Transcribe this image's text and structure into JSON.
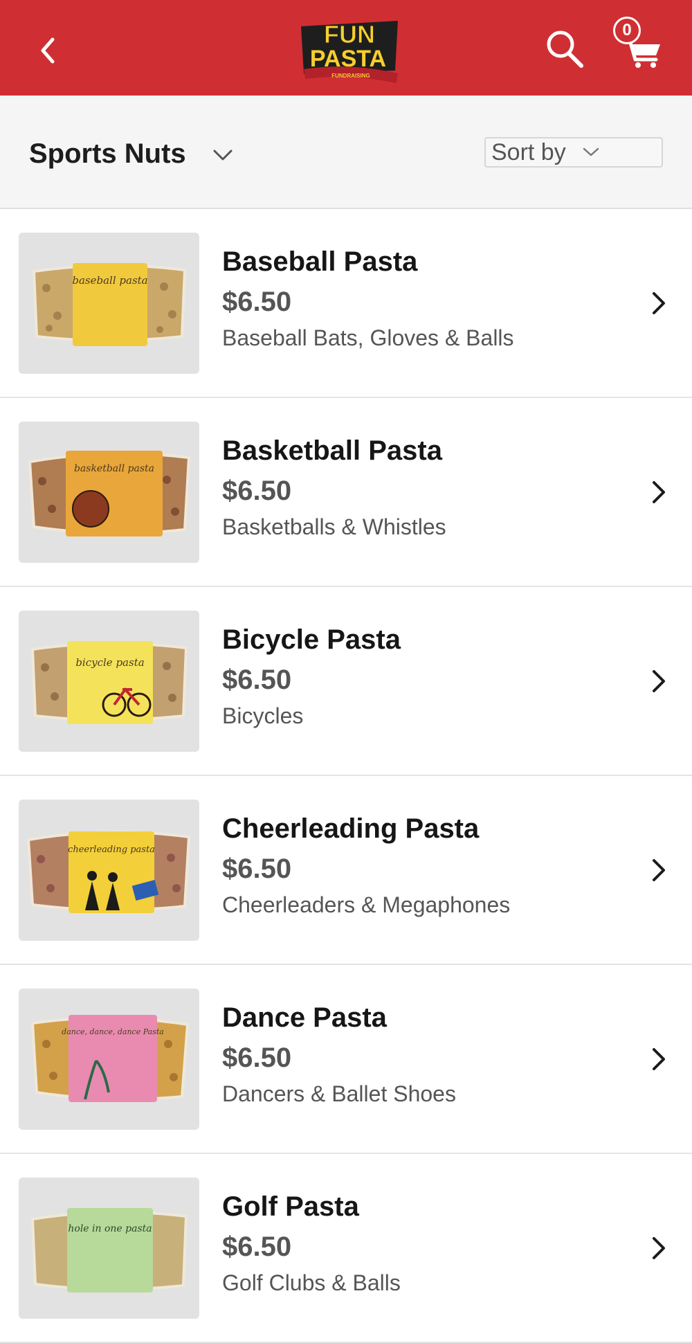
{
  "header": {
    "logo_line1": "FUN",
    "logo_line2": "PASTA",
    "logo_ribbon": "FUNDRAISING",
    "cart_count": "0"
  },
  "filter": {
    "category": "Sports Nuts",
    "sort_label": "Sort by"
  },
  "products": [
    {
      "name": "Baseball Pasta",
      "price": "$6.50",
      "description": "Baseball Bats, Gloves & Balls",
      "package_text": "baseball pasta",
      "label_color": "#f1c93d"
    },
    {
      "name": "Basketball Pasta",
      "price": "$6.50",
      "description": "Basketballs & Whistles",
      "package_text": "basketball pasta",
      "label_color": "#e9a63a"
    },
    {
      "name": "Bicycle Pasta",
      "price": "$6.50",
      "description": "Bicycles",
      "package_text": "bicycle pasta",
      "label_color": "#f4e35a"
    },
    {
      "name": "Cheerleading Pasta",
      "price": "$6.50",
      "description": "Cheerleaders & Megaphones",
      "package_text": "cheerleading pasta",
      "label_color": "#f3cf3a"
    },
    {
      "name": "Dance Pasta",
      "price": "$6.50",
      "description": "Dancers & Ballet Shoes",
      "package_text": "dance, dance, dance Pasta",
      "label_color": "#e98bb0"
    },
    {
      "name": "Golf Pasta",
      "price": "$6.50",
      "description": "Golf Clubs & Balls",
      "package_text": "hole in one pasta",
      "label_color": "#b7d99a"
    }
  ],
  "colors": {
    "header_red": "#cf2f33",
    "filter_bg": "#f5f5f5"
  }
}
